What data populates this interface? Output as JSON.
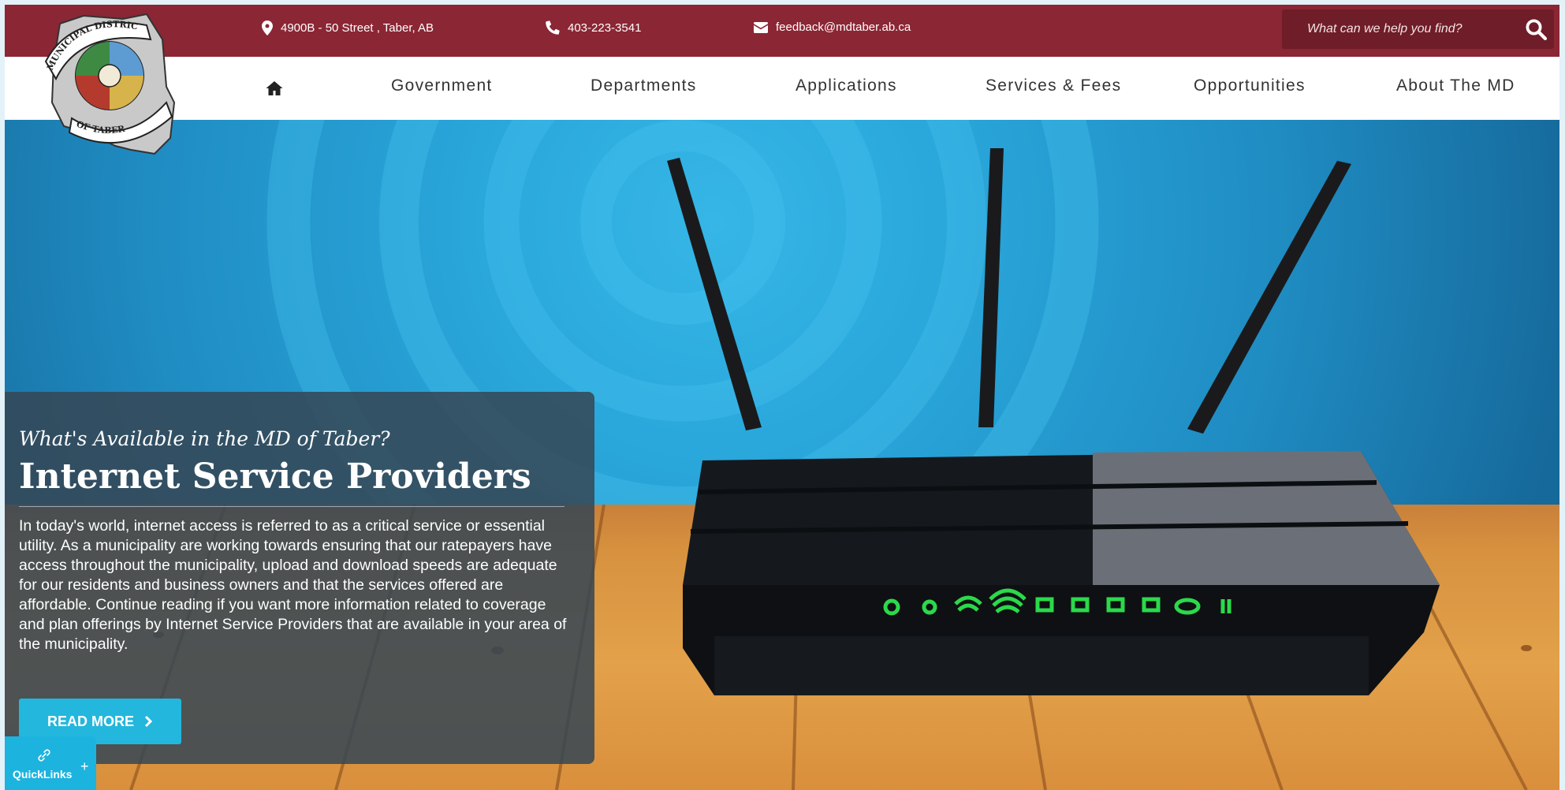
{
  "topbar": {
    "address": "4900B - 50 Street , Taber, AB",
    "phone": "403-223-3541",
    "email": "feedback@mdtaber.ab.ca",
    "search_placeholder": "What can we help you find?"
  },
  "logo": {
    "text_top": "MUNICIPAL DISTRICT",
    "text_bottom": "OF TABER"
  },
  "nav": {
    "items": [
      "Government",
      "Departments",
      "Applications",
      "Services & Fees",
      "Opportunities",
      "About The MD"
    ]
  },
  "hero": {
    "subtitle": "What's Available in the MD of Taber?",
    "title": "Internet Service Providers",
    "body": "In today's world, internet access is referred to as a critical service or essential utility. As a municipality are working towards ensuring that our ratepayers have access throughout the municipality, upload and download speeds are adequate for our residents and business owners and that the services offered are affordable. Continue reading if you want more information related to coverage and plan offerings by Internet Service Providers that are available in your area of the municipality.",
    "button_label": "READ MORE"
  },
  "quicklinks": {
    "label": "QuickLinks"
  },
  "colors": {
    "topbar": "#8b2634",
    "accent": "#23b7dd",
    "router_lights": "#2bd94a"
  }
}
